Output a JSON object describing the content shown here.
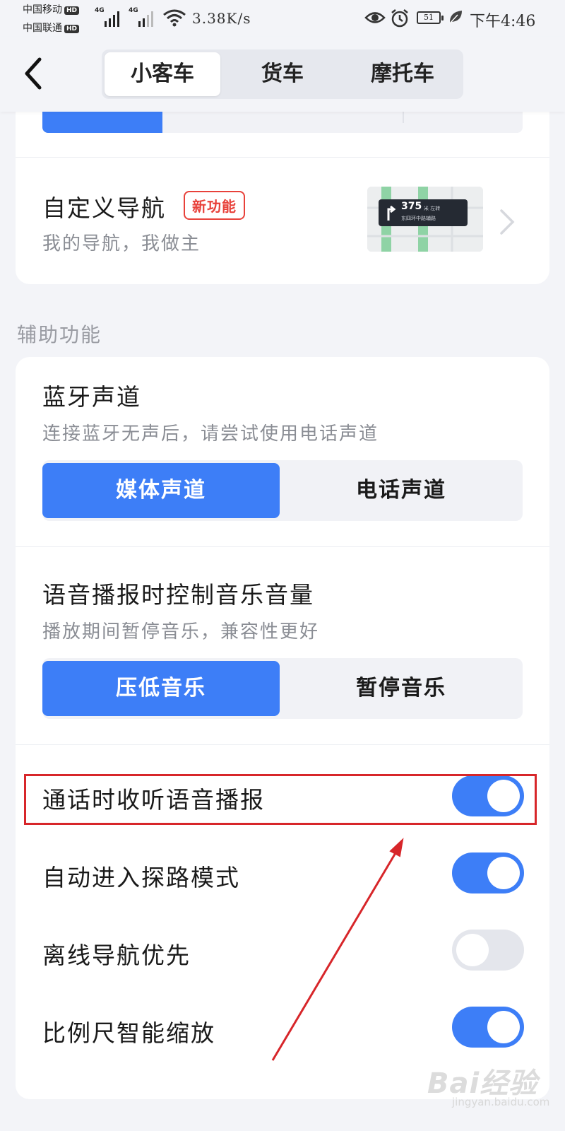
{
  "status_bar": {
    "carrier_1": "中国移动",
    "carrier_2": "中国联通",
    "hd_label": "HD",
    "network_label": "4G",
    "net_speed": "3.38K/s",
    "battery_level": "51",
    "time": "下午4:46"
  },
  "header": {
    "back_icon": "chevron-left-icon",
    "tabs": [
      {
        "label": "小客车",
        "active": true
      },
      {
        "label": "货车",
        "active": false
      },
      {
        "label": "摩托车",
        "active": false
      }
    ]
  },
  "custom_nav": {
    "title": "自定义导航",
    "badge": "新功能",
    "subtitle": "我的导航，我做主",
    "preview_distance": "375",
    "preview_unit": "米 左转",
    "preview_road": "东四环中路辅路"
  },
  "section_label": "辅助功能",
  "bluetooth": {
    "title": "蓝牙声道",
    "subtitle": "连接蓝牙无声后，请尝试使用电话声道",
    "options": [
      {
        "label": "媒体声道",
        "selected": true
      },
      {
        "label": "电话声道",
        "selected": false
      }
    ]
  },
  "music_volume": {
    "title": "语音播报时控制音乐音量",
    "subtitle": "播放期间暂停音乐，兼容性更好",
    "options": [
      {
        "label": "压低音乐",
        "selected": true
      },
      {
        "label": "暂停音乐",
        "selected": false
      }
    ]
  },
  "toggles": [
    {
      "label": "通话时收听语音播报",
      "on": true
    },
    {
      "label": "自动进入探路模式",
      "on": true
    },
    {
      "label": "离线导航优先",
      "on": false
    },
    {
      "label": "比例尺智能缩放",
      "on": true
    }
  ],
  "colors": {
    "accent": "#3d7ef7",
    "highlight": "#d7262a",
    "badge": "#e8413a"
  },
  "watermark": {
    "brand": "Bai经验",
    "url": "jingyan.baidu.com"
  }
}
